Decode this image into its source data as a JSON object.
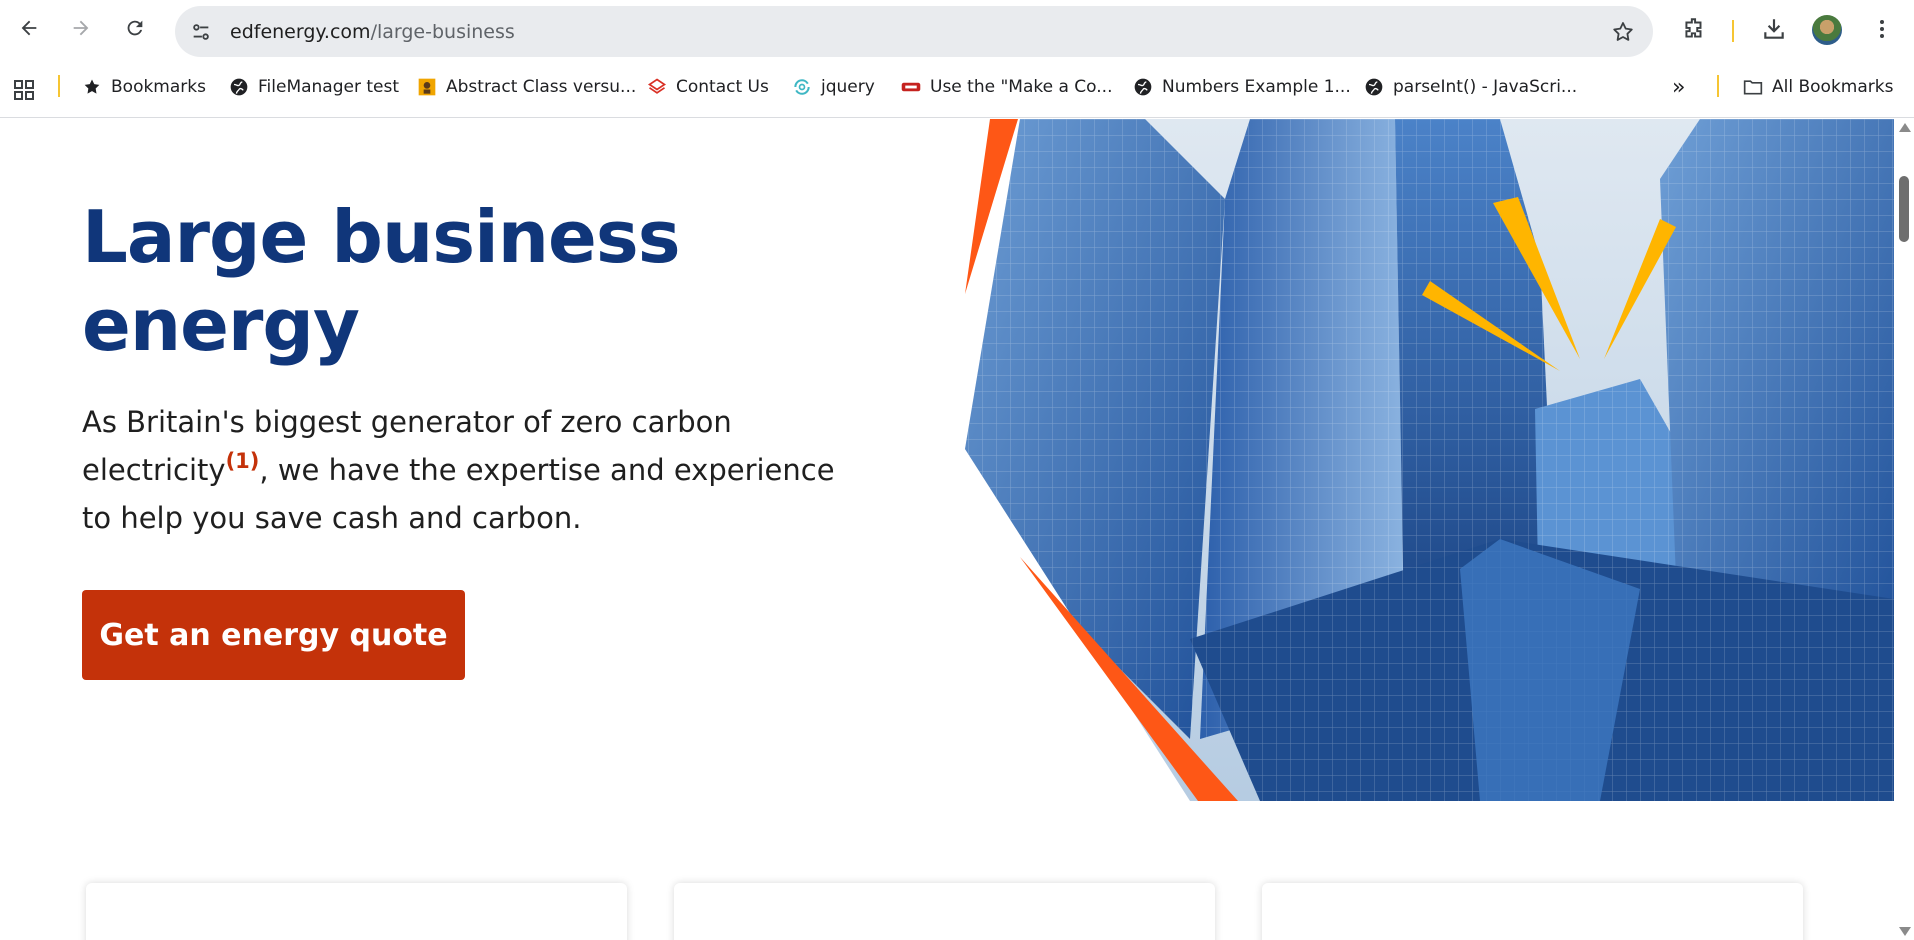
{
  "browser": {
    "url_domain": "edfenergy.com",
    "url_path": "/large-business",
    "bookmarks": [
      {
        "label": "Bookmarks",
        "icon": "star-icon"
      },
      {
        "label": "FileManager test",
        "icon": "globe-icon"
      },
      {
        "label": "Abstract Class versu...",
        "icon": "site-favicon-icon"
      },
      {
        "label": "Contact Us",
        "icon": "site-favicon-icon"
      },
      {
        "label": "jquery",
        "icon": "site-favicon-icon"
      },
      {
        "label": "Use the \"Make a Co...",
        "icon": "site-favicon-icon"
      },
      {
        "label": "Numbers Example 1...",
        "icon": "globe-icon"
      },
      {
        "label": "parseInt() - JavaScri...",
        "icon": "globe-icon"
      }
    ],
    "more_bookmarks": "»",
    "all_bookmarks": "All Bookmarks"
  },
  "hero": {
    "title": "Large business energy",
    "text_part1": "As Britain's biggest generator of zero carbon electricity",
    "footnote": "(1)",
    "text_part2": ", we have the expertise and experience to help you save cash and carbon.",
    "cta_label": "Get an energy quote"
  },
  "colors": {
    "brand_navy": "#10367a",
    "cta_orange": "#c4320a",
    "accent_orange": "#fe5716",
    "accent_yellow": "#ffb500"
  }
}
